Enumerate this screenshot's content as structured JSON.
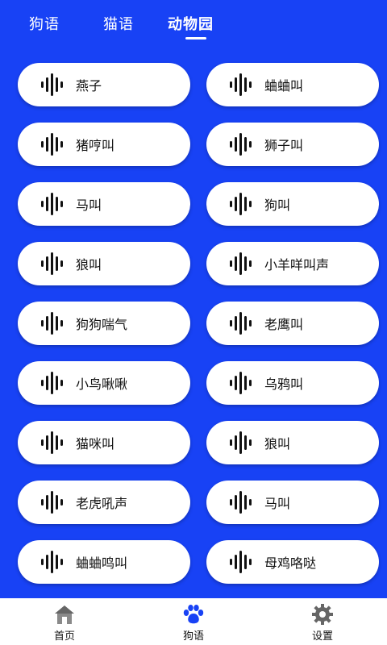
{
  "tabs": [
    {
      "label": "狗语"
    },
    {
      "label": "猫语"
    },
    {
      "label": "动物园"
    }
  ],
  "active_tab": "动物园",
  "sounds": [
    {
      "label": "燕子"
    },
    {
      "label": "蛐蛐叫"
    },
    {
      "label": "猪哼叫"
    },
    {
      "label": "狮子叫"
    },
    {
      "label": "马叫"
    },
    {
      "label": "狗叫"
    },
    {
      "label": "狼叫"
    },
    {
      "label": "小羊咩叫声"
    },
    {
      "label": "狗狗喘气"
    },
    {
      "label": "老鹰叫"
    },
    {
      "label": "小鸟啾啾"
    },
    {
      "label": "乌鸦叫"
    },
    {
      "label": "猫咪叫"
    },
    {
      "label": "狼叫"
    },
    {
      "label": "老虎吼声"
    },
    {
      "label": "马叫"
    },
    {
      "label": "蛐蛐鸣叫"
    },
    {
      "label": "母鸡咯哒"
    }
  ],
  "bottom_nav": [
    {
      "label": "首页",
      "icon": "home-icon"
    },
    {
      "label": "狗语",
      "icon": "paw-icon",
      "active": true
    },
    {
      "label": "设置",
      "icon": "gear-icon"
    }
  ],
  "colors": {
    "background": "#1842f5",
    "pill": "#ffffff",
    "paw_active": "#1842f5",
    "icon_gray": "#666666"
  }
}
